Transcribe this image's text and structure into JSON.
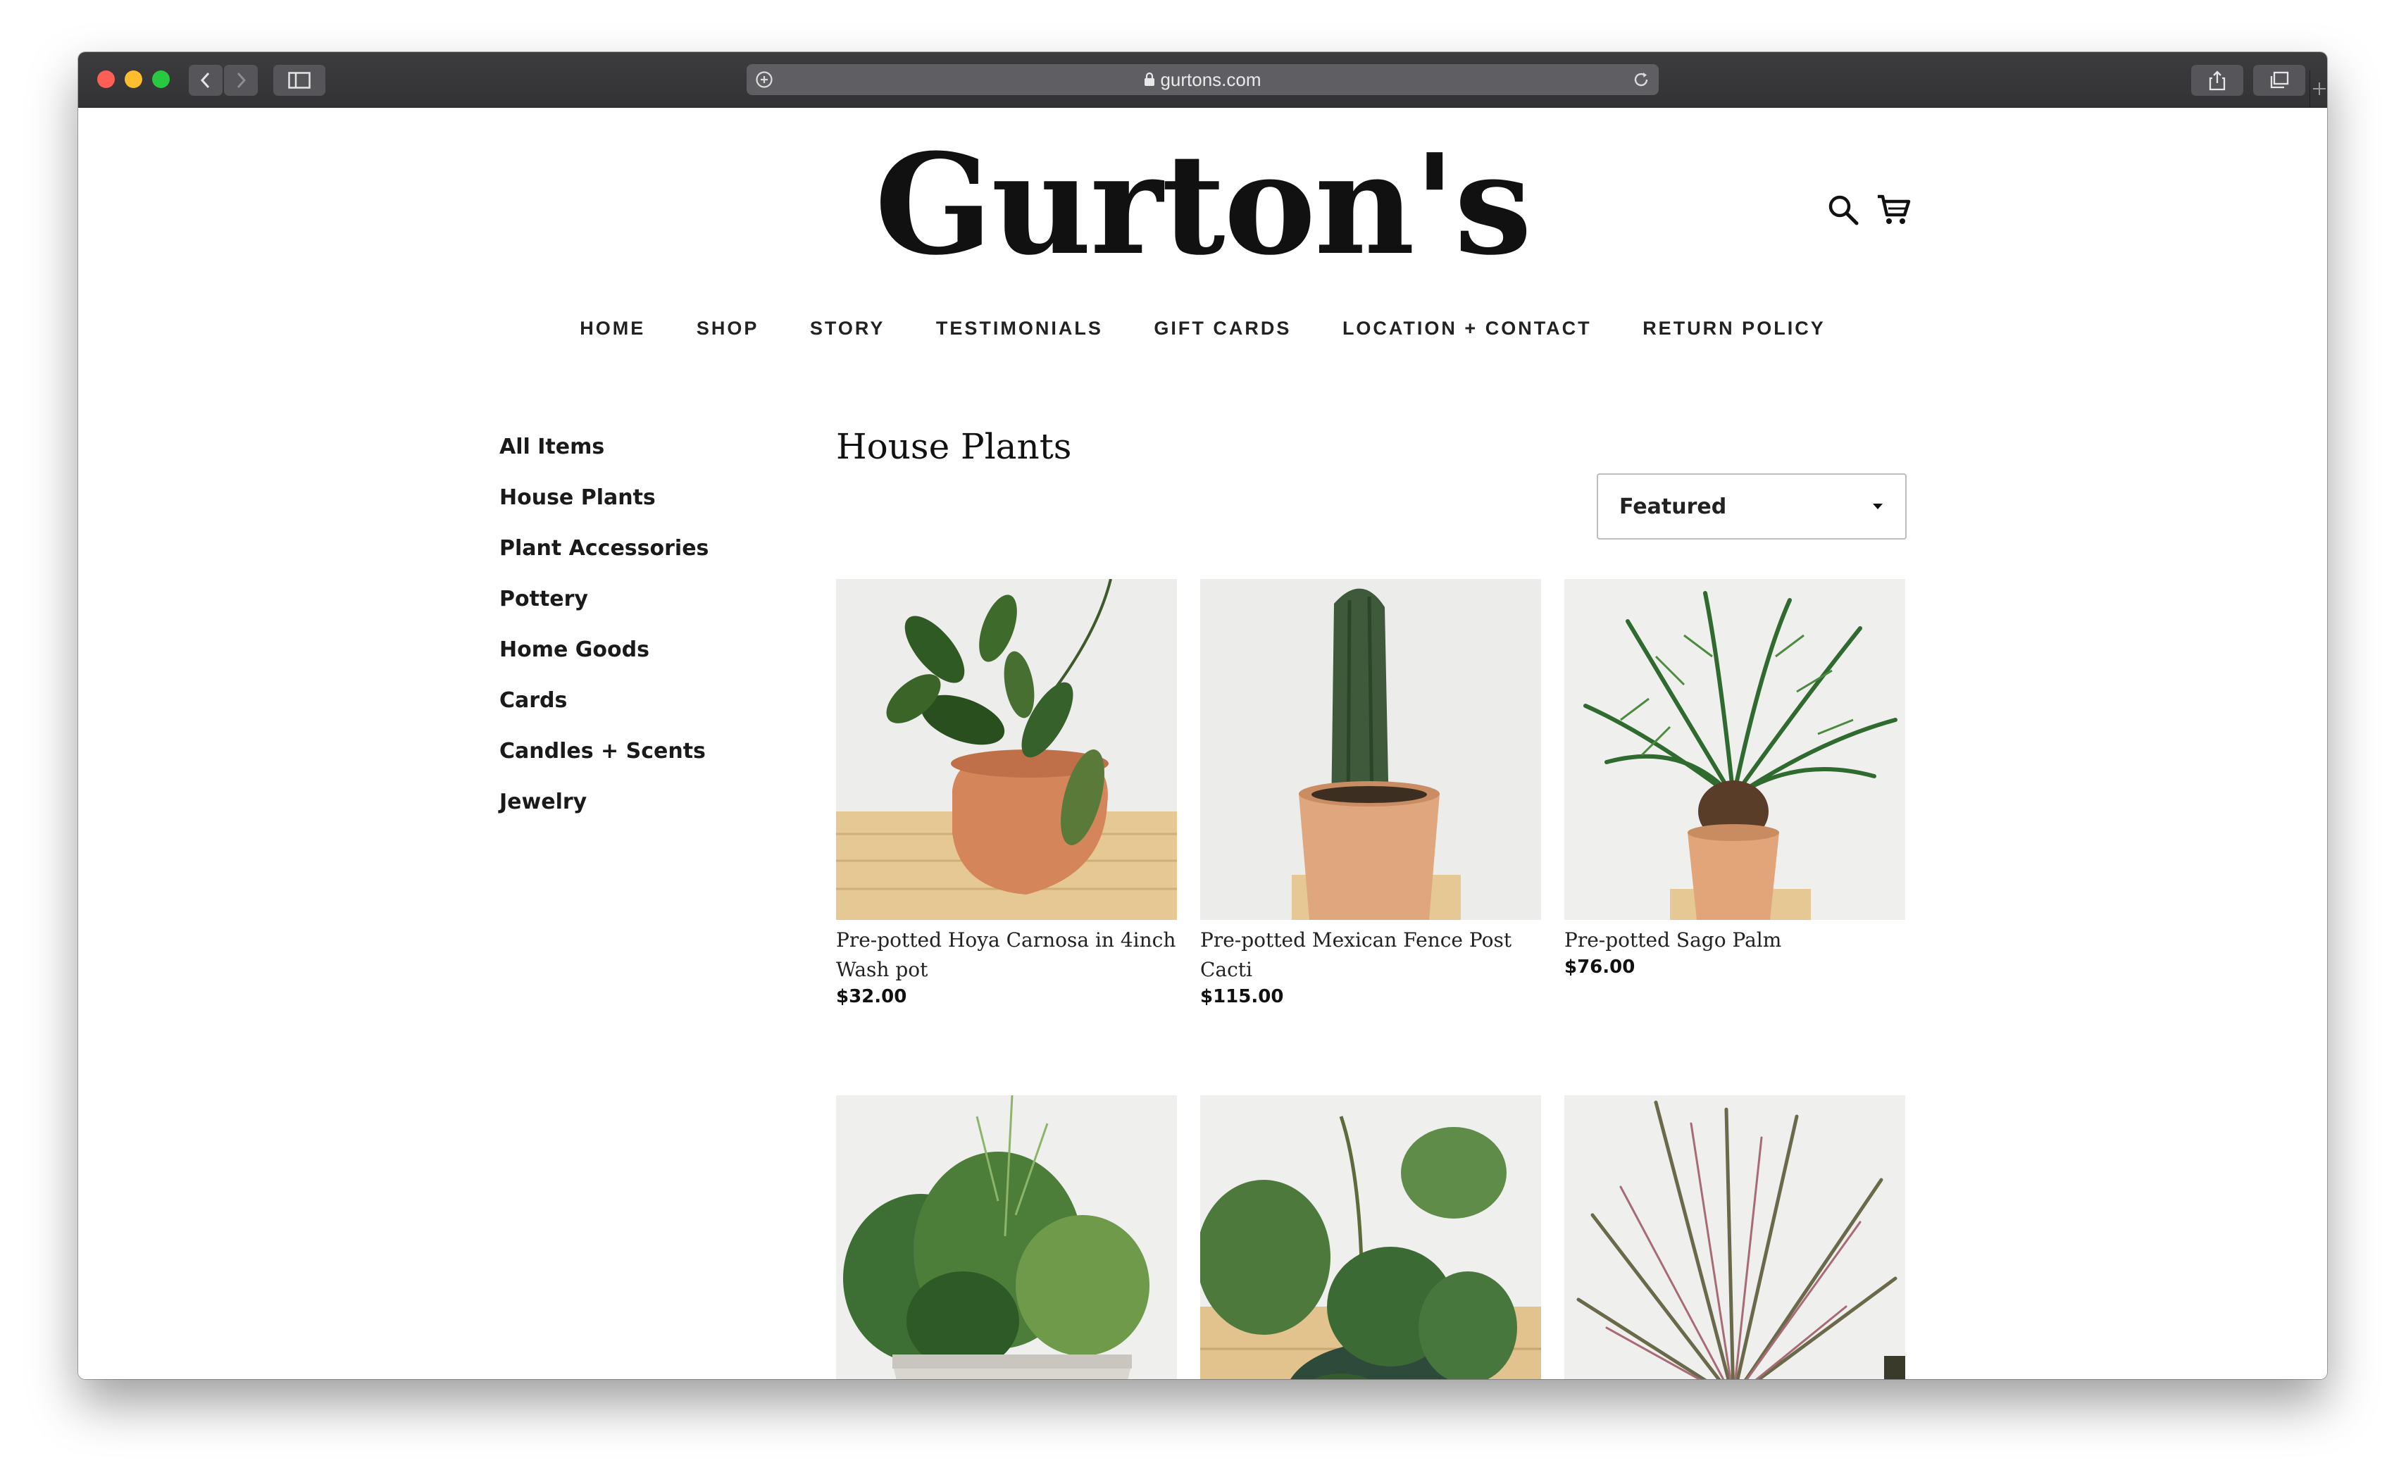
{
  "browser": {
    "url": "gurtons.com"
  },
  "site": {
    "logo": "Gurton's"
  },
  "nav": {
    "items": [
      "HOME",
      "SHOP",
      "STORY",
      "TESTIMONIALS",
      "GIFT CARDS",
      "LOCATION + CONTACT",
      "RETURN POLICY"
    ]
  },
  "sidebar": {
    "items": [
      "All Items",
      "House Plants",
      "Plant Accessories",
      "Pottery",
      "Home Goods",
      "Cards",
      "Candles + Scents",
      "Jewelry"
    ]
  },
  "collection": {
    "title": "House Plants",
    "sort": {
      "selected": "Featured"
    }
  },
  "products": [
    {
      "name": "Pre-potted Hoya Carnosa in 4inch Wash pot",
      "price": "$32.00",
      "image": "hoya-plant"
    },
    {
      "name": "Pre-potted Mexican Fence Post Cacti",
      "price": "$115.00",
      "image": "cactus"
    },
    {
      "name": "Pre-potted Sago Palm",
      "price": "$76.00",
      "image": "sago-palm"
    },
    {
      "name": "",
      "price": "",
      "image": "fern-arrangement"
    },
    {
      "name": "",
      "price": "",
      "image": "hoya-obovata"
    },
    {
      "name": "",
      "price": "",
      "image": "dracaena"
    }
  ],
  "colors": {
    "titlebar": "#3a3a3c",
    "text": "#111111",
    "shelf": "#e8c896",
    "pot": "#d98c5f"
  }
}
